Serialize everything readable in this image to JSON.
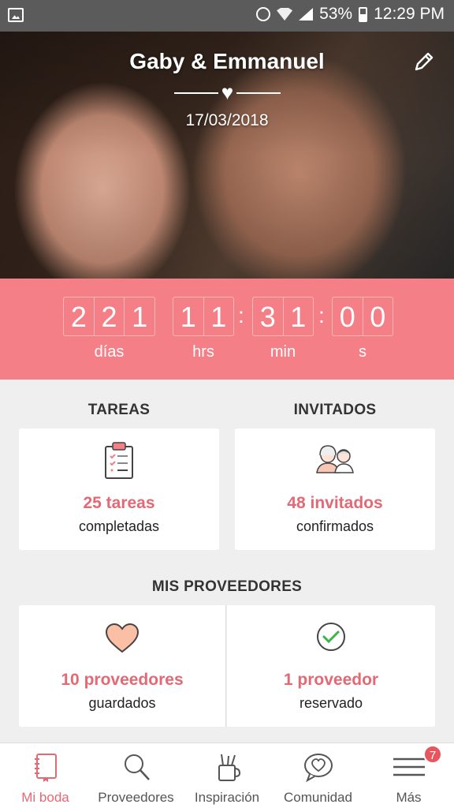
{
  "status_bar": {
    "battery": "53%",
    "time": "12:29 PM"
  },
  "header": {
    "couple": "Gaby & Emmanuel",
    "date": "17/03/2018"
  },
  "countdown": {
    "days": [
      "2",
      "2",
      "1"
    ],
    "hours": [
      "1",
      "1"
    ],
    "minutes": [
      "3",
      "1"
    ],
    "seconds": [
      "0",
      "0"
    ],
    "labels": {
      "days": "días",
      "hours": "hrs",
      "minutes": "min",
      "seconds": "s"
    }
  },
  "tasks": {
    "title": "TAREAS",
    "value": "25 tareas",
    "caption": "completadas"
  },
  "guests": {
    "title": "INVITADOS",
    "value": "48 invitados",
    "caption": "confirmados"
  },
  "vendors": {
    "title": "MIS PROVEEDORES",
    "saved": {
      "value": "10 proveedores",
      "caption": "guardados"
    },
    "booked": {
      "value": "1 proveedor",
      "caption": "reservado"
    }
  },
  "nav": {
    "items": [
      {
        "label": "Mi boda",
        "icon": "notebook-icon"
      },
      {
        "label": "Proveedores",
        "icon": "search-icon"
      },
      {
        "label": "Inspiración",
        "icon": "brushes-icon"
      },
      {
        "label": "Comunidad",
        "icon": "chat-heart-icon"
      },
      {
        "label": "Más",
        "icon": "menu-icon"
      }
    ],
    "badge": "7"
  },
  "colors": {
    "accent": "#f57f86",
    "accent_text": "#e56874",
    "background": "#efefef"
  }
}
